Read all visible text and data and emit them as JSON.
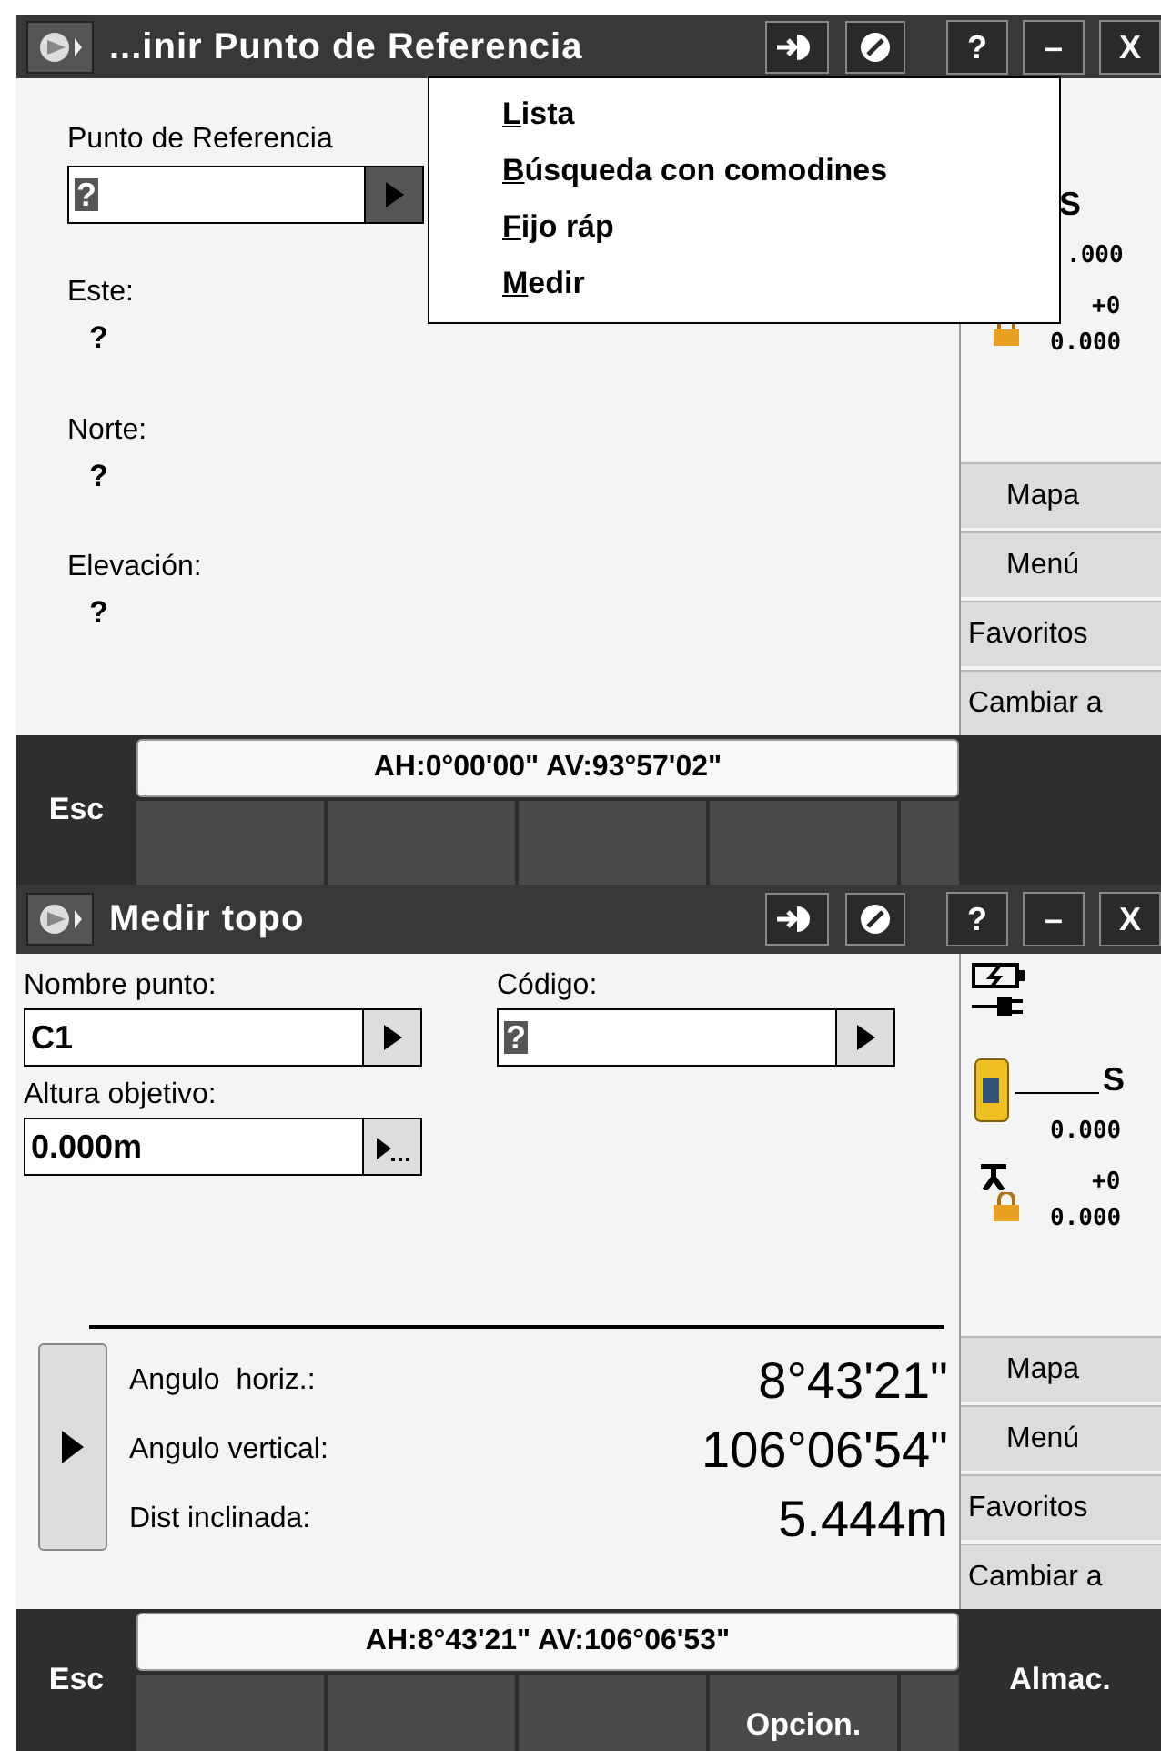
{
  "screens": [
    {
      "kind": "reference",
      "title": "...inir Punto de Referencia",
      "title_buttons": [
        "?",
        "–",
        "X"
      ],
      "field": {
        "label": "Punto de Referencia",
        "value": "?",
        "selected": true
      },
      "readouts": [
        {
          "label": "Este:",
          "value": "?"
        },
        {
          "label": "Norte:",
          "value": "?"
        },
        {
          "label": "Elevación:",
          "value": "?"
        }
      ],
      "menu": [
        "Lista",
        "Búsqueda con comodines",
        "Fijo ráp",
        "Medir"
      ],
      "side": {
        "letter": "S",
        "value_1": ".000",
        "offset": "+0",
        "value_2": "0.000",
        "buttons": [
          "Mapa",
          "Menú",
          "Favoritos",
          "Cambiar a"
        ]
      },
      "esc": "Esc",
      "status": "AH:0°00'00\"  AV:93°57'02\""
    },
    {
      "kind": "topo",
      "title": "Medir topo",
      "title_buttons": [
        "?",
        "–",
        "X"
      ],
      "fields": [
        {
          "label": "Nombre punto:",
          "value": "C1",
          "selected": false,
          "kind": "arrow"
        },
        {
          "label": "Código:",
          "value": "?",
          "selected": true,
          "kind": "arrow"
        },
        {
          "label": "Altura objetivo:",
          "value": "0.000m",
          "selected": false,
          "kind": "more"
        }
      ],
      "measurements": [
        {
          "label": "Angulo  horiz.:",
          "value": "8°43'21\""
        },
        {
          "label": "Angulo vertical:",
          "value": "106°06'54\""
        },
        {
          "label": "Dist inclinada:",
          "value": "5.444m"
        }
      ],
      "side": {
        "letter": "S",
        "value_1": "0.000",
        "offset": "+0",
        "value_2": "0.000",
        "buttons": [
          "Mapa",
          "Menú",
          "Favoritos",
          "Cambiar a"
        ]
      },
      "esc": "Esc",
      "status": "AH:8°43'21\"  AV:106°06'53\"",
      "option_key": "Opcion.",
      "action": "Almac."
    }
  ]
}
